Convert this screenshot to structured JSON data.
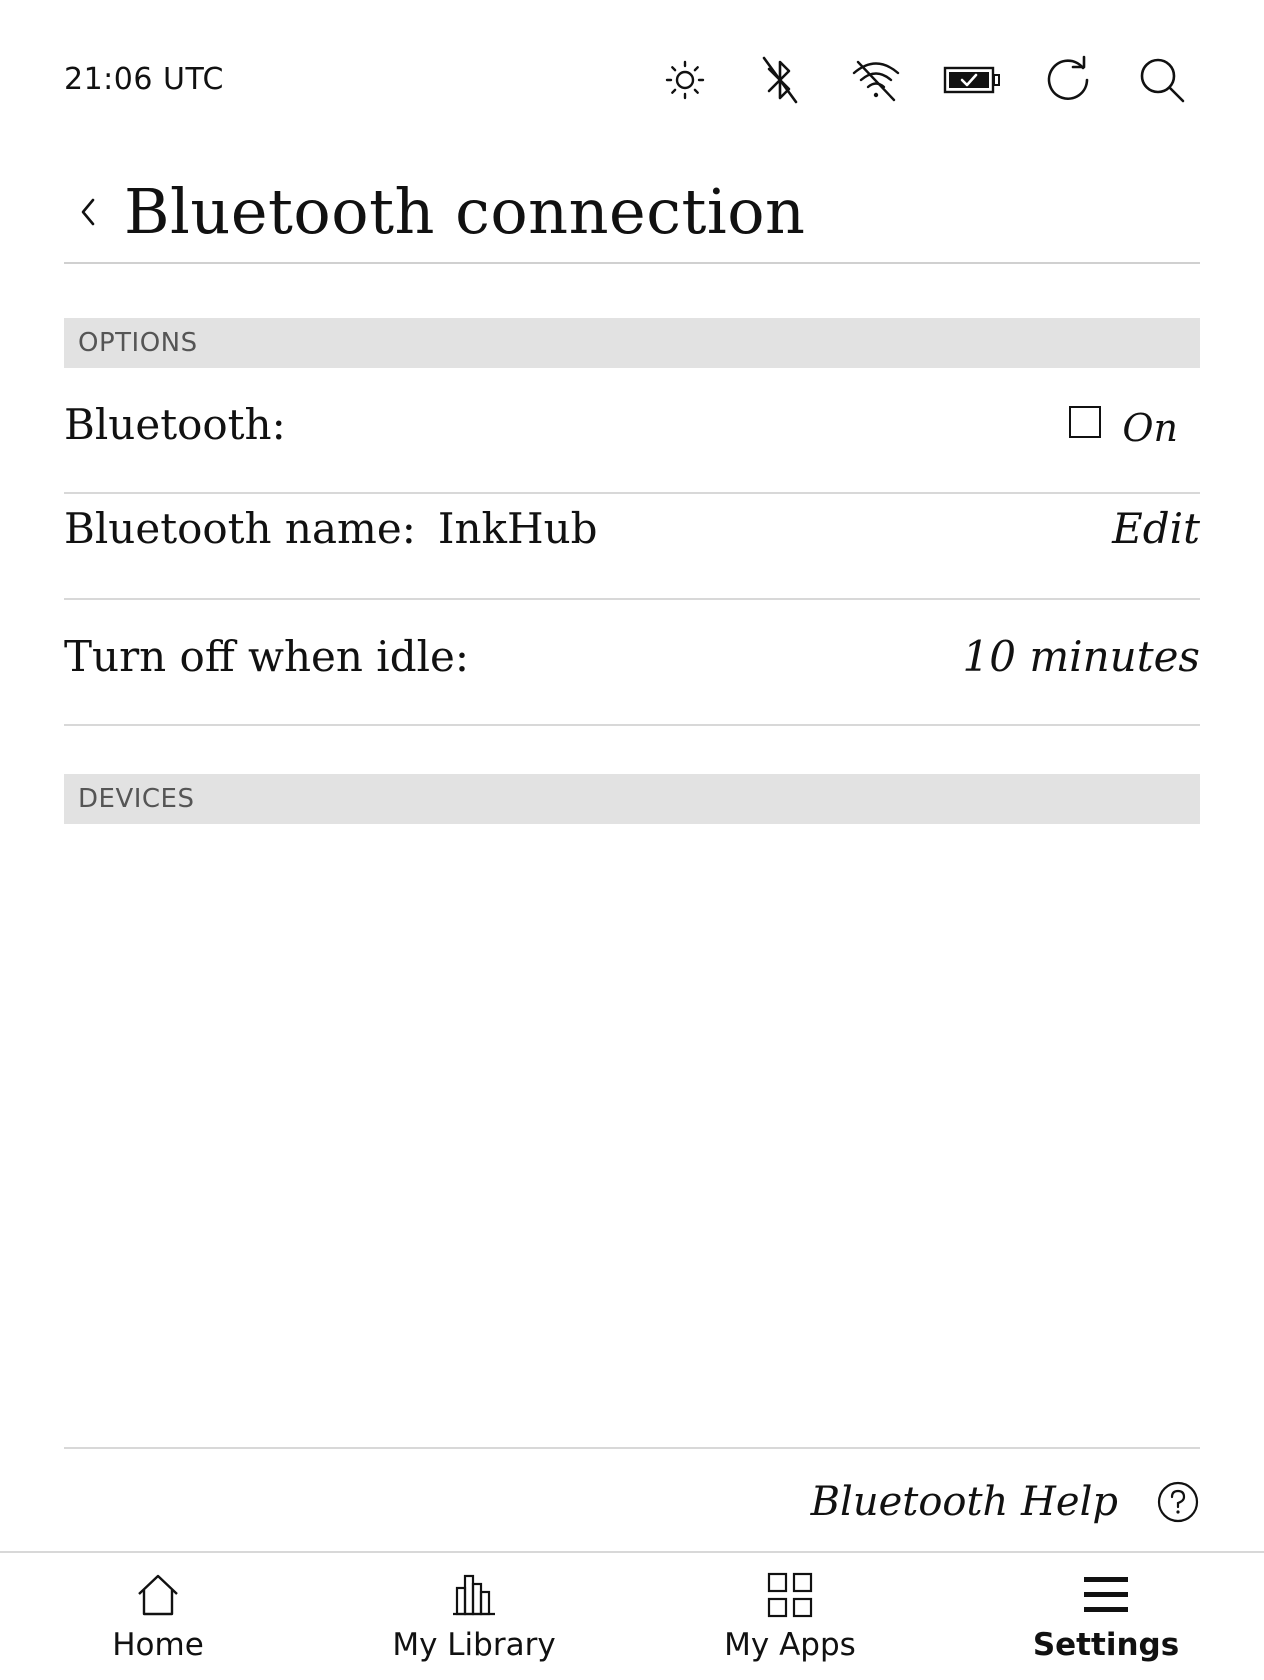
{
  "status_bar": {
    "clock": "21:06 UTC",
    "icons": [
      "brightness-icon",
      "bluetooth-off-icon",
      "wifi-off-icon",
      "battery-charged-icon",
      "sync-icon",
      "search-icon"
    ]
  },
  "header": {
    "back_icon": "chevron-left-icon",
    "title": "Bluetooth connection"
  },
  "sections": {
    "options_label": "OPTIONS",
    "devices_label": "DEVICES"
  },
  "options": {
    "bluetooth": {
      "label": "Bluetooth:",
      "checked": false,
      "state_label": "On"
    },
    "name": {
      "label": "Bluetooth name:",
      "value": "InkHub",
      "action_label": "Edit"
    },
    "idle": {
      "label": "Turn off when idle:",
      "value": "10 minutes"
    }
  },
  "devices": [],
  "footer": {
    "help_label": "Bluetooth Help",
    "help_icon": "help-circle-icon"
  },
  "bottom_nav": {
    "items": [
      {
        "label": "Home",
        "icon": "home-icon",
        "active": false
      },
      {
        "label": "My Library",
        "icon": "library-icon",
        "active": false
      },
      {
        "label": "My Apps",
        "icon": "apps-icon",
        "active": false
      },
      {
        "label": "Settings",
        "icon": "menu-icon",
        "active": true
      }
    ]
  },
  "colors": {
    "section_header_bg": "#e2e2e2",
    "section_header_text": "#555555",
    "divider": "#d8d8d8",
    "text": "#111111"
  }
}
